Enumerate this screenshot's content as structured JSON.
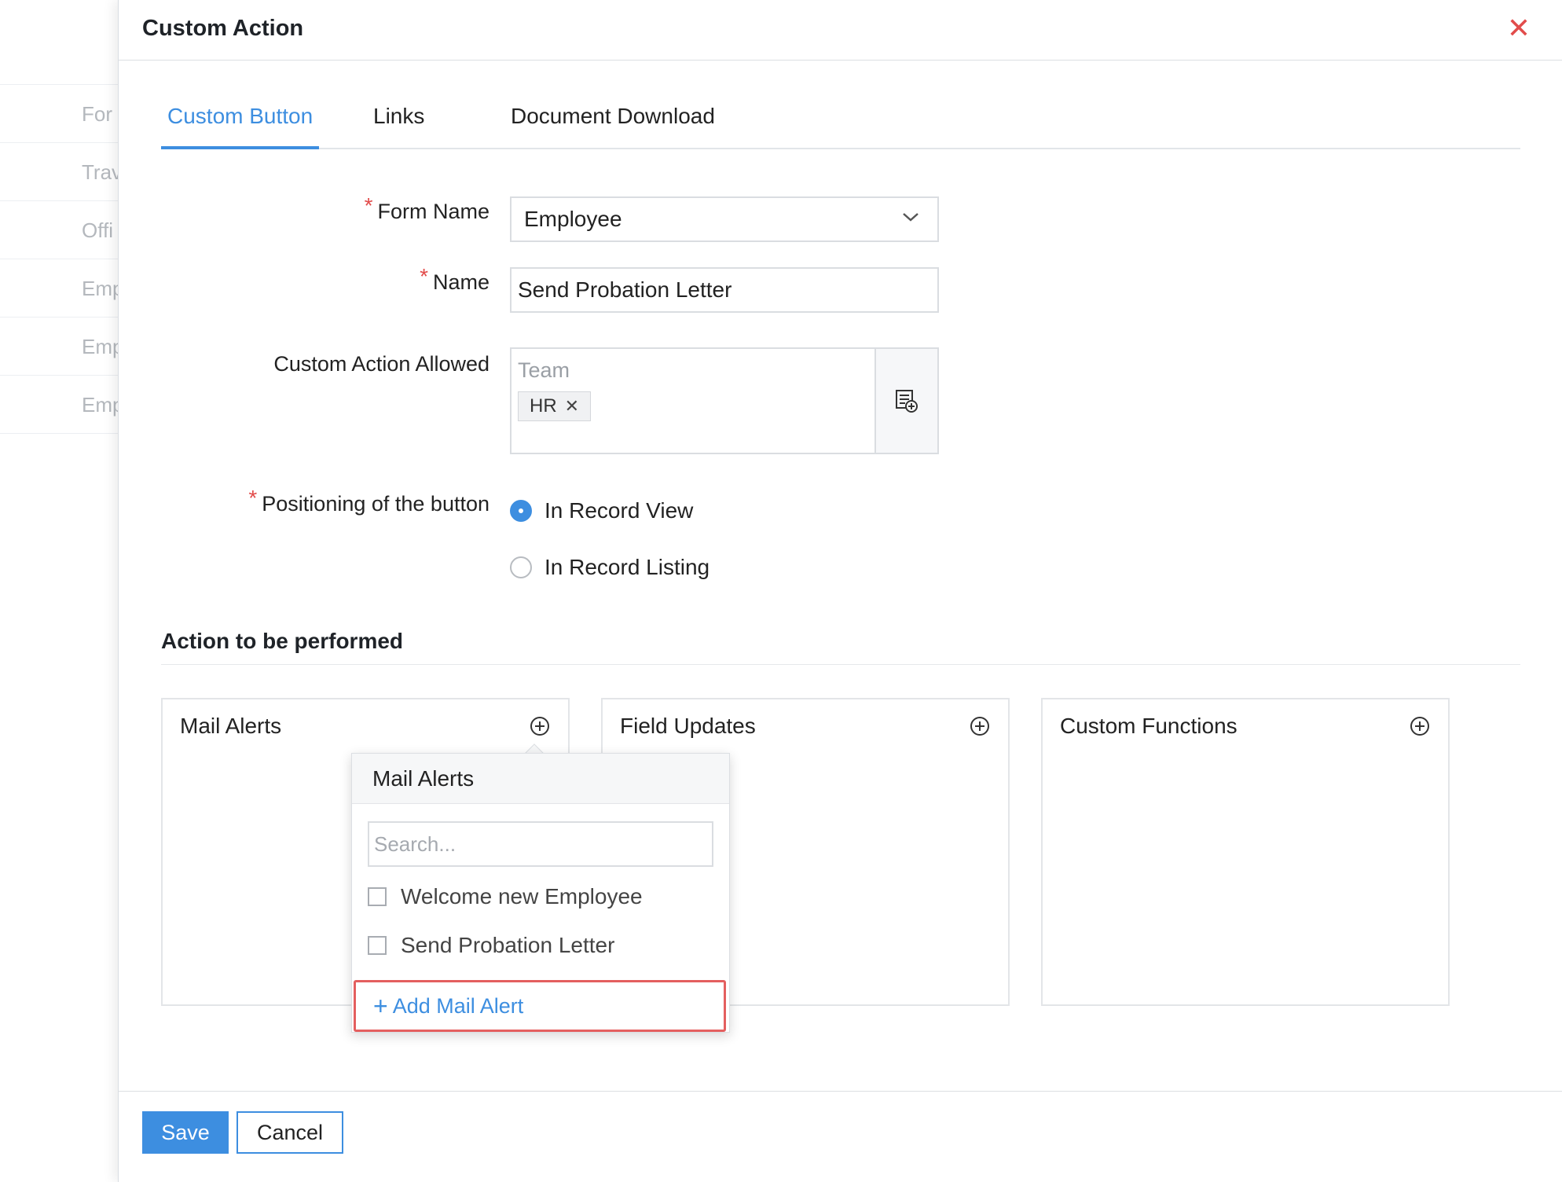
{
  "background": {
    "rows": [
      "For",
      "Trav",
      "Offi",
      "Emp",
      "Emp",
      "Emp"
    ]
  },
  "dialog": {
    "title": "Custom Action",
    "close_icon": "close-icon",
    "tabs": [
      {
        "label": "Custom Button",
        "active": true
      },
      {
        "label": "Links",
        "active": false
      },
      {
        "label": "Document Download",
        "active": false
      }
    ]
  },
  "form": {
    "form_name": {
      "label": "Form Name",
      "required": true,
      "value": "Employee"
    },
    "name": {
      "label": "Name",
      "required": true,
      "value": "Send Probation Letter"
    },
    "custom_action_allowed": {
      "label": "Custom Action Allowed",
      "placeholder": "Team",
      "chips": [
        "HR"
      ]
    },
    "positioning": {
      "label": "Positioning of the button",
      "required": true,
      "options": [
        {
          "label": "In Record View",
          "selected": true
        },
        {
          "label": "In Record Listing",
          "selected": false
        }
      ]
    }
  },
  "actions": {
    "title": "Action to be performed",
    "cards": [
      {
        "title": "Mail Alerts"
      },
      {
        "title": "Field Updates"
      },
      {
        "title": "Custom Functions"
      }
    ],
    "mail_alert_popover": {
      "title": "Mail Alerts",
      "search_placeholder": "Search...",
      "items": [
        "Welcome new Employee",
        "Send Probation Letter"
      ],
      "add_label": "Add Mail Alert"
    }
  },
  "footer": {
    "save_label": "Save",
    "cancel_label": "Cancel"
  },
  "colors": {
    "accent": "#3d8ee0",
    "danger": "#e24c4b"
  }
}
